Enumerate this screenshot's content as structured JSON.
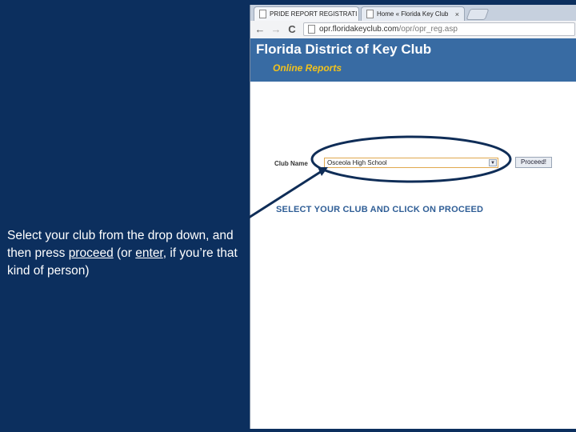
{
  "browser": {
    "tabs": [
      {
        "title": "PRIDE REPORT REGISTRATI",
        "close": "×"
      },
      {
        "title": "Home « Florida Key Club",
        "close": "×"
      }
    ],
    "nav": {
      "back": "←",
      "forward": "→",
      "reload": "C"
    },
    "url": {
      "host": "opr.floridakeyclub.com",
      "path": "/opr/opr_reg.asp"
    }
  },
  "site": {
    "title": "Florida District of Key Club",
    "subtitle": "Online Reports"
  },
  "form": {
    "club_label": "Club Name",
    "club_selected": "Osceola High School",
    "proceed_label": "Proceed!",
    "instruction": "SELECT YOUR CLUB AND CLICK ON PROCEED"
  },
  "caption": {
    "part1": "Select your club from the drop down, and then press ",
    "link1": "proceed",
    "part2": " (or ",
    "link2": "enter",
    "part3": ", if you’re that kind of person)"
  },
  "colors": {
    "slide_bg": "#0c2f5e",
    "header_bg": "#386ba3",
    "subtitle": "#f2c21c",
    "annotation": "#0f2d57"
  }
}
